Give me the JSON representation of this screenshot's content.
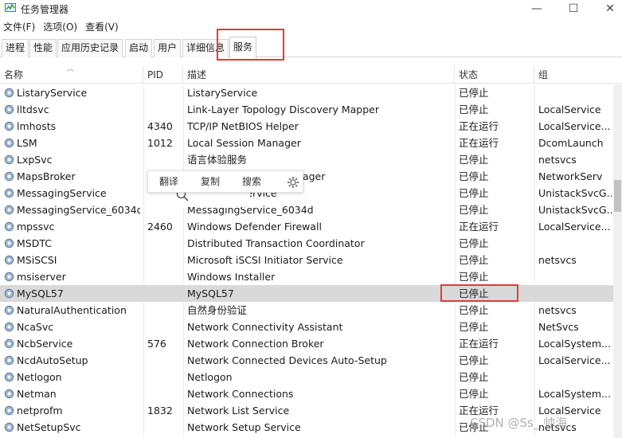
{
  "window": {
    "title": "任务管理器",
    "min_glyph": "—",
    "max_glyph": "☐",
    "close_glyph": "✕"
  },
  "menu": [
    "文件(F)",
    "选项(O)",
    "查看(V)"
  ],
  "tabs": [
    {
      "label": "进程"
    },
    {
      "label": "性能"
    },
    {
      "label": "应用历史记录"
    },
    {
      "label": "启动"
    },
    {
      "label": "用户"
    },
    {
      "label": "详细信息"
    },
    {
      "label": "服务",
      "active": true
    }
  ],
  "columns": {
    "name": "名称",
    "pid": "PID",
    "desc": "描述",
    "status": "状态",
    "group": "组"
  },
  "rows": [
    {
      "name": "ListaryService",
      "pid": "",
      "desc": "ListaryService",
      "status": "已停止",
      "group": ""
    },
    {
      "name": "lltdsvc",
      "pid": "",
      "desc": "Link-Layer Topology Discovery Mapper",
      "status": "已停止",
      "group": "LocalService"
    },
    {
      "name": "lmhosts",
      "pid": "4340",
      "desc": "TCP/IP NetBIOS Helper",
      "status": "正在运行",
      "group": "LocalService..."
    },
    {
      "name": "LSM",
      "pid": "1012",
      "desc": "Local Session Manager",
      "status": "正在运行",
      "group": "DcomLaunch"
    },
    {
      "name": "LxpSvc",
      "pid": "",
      "desc": "语言体验服务",
      "status": "已停止",
      "group": "netsvcs"
    },
    {
      "name": "MapsBroker",
      "pid": "",
      "desc": "Downloaded Maps Manager",
      "status": "已停止",
      "group": "NetworkServ"
    },
    {
      "name": "MessagingService",
      "pid": "",
      "desc": "MessagingService",
      "status": "已停止",
      "group": "UnistackSvcG..."
    },
    {
      "name": "MessagingService_6034d",
      "pid": "",
      "desc": "MessagingService_6034d",
      "status": "已停止",
      "group": "UnistackSvcG..."
    },
    {
      "name": "mpssvc",
      "pid": "2460",
      "desc": "Windows Defender Firewall",
      "status": "正在运行",
      "group": "LocalService..."
    },
    {
      "name": "MSDTC",
      "pid": "",
      "desc": "Distributed Transaction Coordinator",
      "status": "已停止",
      "group": ""
    },
    {
      "name": "MSiSCSI",
      "pid": "",
      "desc": "Microsoft iSCSI Initiator Service",
      "status": "已停止",
      "group": "netsvcs"
    },
    {
      "name": "msiserver",
      "pid": "",
      "desc": "Windows Installer",
      "status": "已停止",
      "group": ""
    },
    {
      "name": "MySQL57",
      "pid": "",
      "desc": "MySQL57",
      "status": "已停止",
      "group": "",
      "selected": true
    },
    {
      "name": "NaturalAuthentication",
      "pid": "",
      "desc": "自然身份验证",
      "status": "已停止",
      "group": "netsvcs"
    },
    {
      "name": "NcaSvc",
      "pid": "",
      "desc": "Network Connectivity Assistant",
      "status": "已停止",
      "group": "NetSvcs"
    },
    {
      "name": "NcbService",
      "pid": "576",
      "desc": "Network Connection Broker",
      "status": "正在运行",
      "group": "LocalSystem..."
    },
    {
      "name": "NcdAutoSetup",
      "pid": "",
      "desc": "Network Connected Devices Auto-Setup",
      "status": "已停止",
      "group": "LocalService..."
    },
    {
      "name": "Netlogon",
      "pid": "",
      "desc": "Netlogon",
      "status": "已停止",
      "group": ""
    },
    {
      "name": "Netman",
      "pid": "",
      "desc": "Network Connections",
      "status": "已停止",
      "group": "LocalSystem..."
    },
    {
      "name": "netprofm",
      "pid": "1832",
      "desc": "Network List Service",
      "status": "正在运行",
      "group": "LocalService"
    },
    {
      "name": "NetSetupSvc",
      "pid": "",
      "desc": "Network Setup Service",
      "status": "已停止",
      "group": "netsvcs"
    }
  ],
  "popup": {
    "translate": "翻译",
    "copy": "复制",
    "search": "搜索"
  },
  "watermark": "CSDN @Ss_ 帅海",
  "colors": {
    "highlight_box": "#e03a3a",
    "selected_row": "#d9d9d9"
  }
}
